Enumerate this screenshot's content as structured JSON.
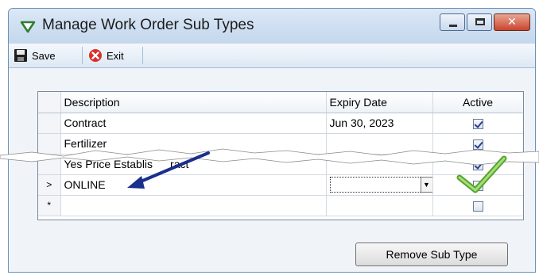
{
  "window": {
    "title": "Manage Work Order Sub Types",
    "controls": {
      "minimize": "minimize",
      "maximize": "maximize",
      "close": "x"
    }
  },
  "toolbar": {
    "save_label": "Save",
    "exit_label": "Exit"
  },
  "grid": {
    "columns": [
      "Description",
      "Expiry Date",
      "Active"
    ],
    "rows": [
      {
        "marker": "",
        "description": "Contract",
        "expiry": "Jun 30, 2023",
        "active": true
      },
      {
        "marker": "",
        "description": "Fertilizer",
        "expiry": "",
        "active": true
      },
      {
        "marker": "",
        "description": "Yes Price Establis",
        "suffix": "ract",
        "expiry": "",
        "active": true
      },
      {
        "marker": ">",
        "description": "ONLINE",
        "expiry": "",
        "active": false
      },
      {
        "marker": "*",
        "description": "",
        "expiry": "",
        "active": false
      }
    ]
  },
  "buttons": {
    "remove_label": "Remove Sub Type"
  },
  "annotation": {
    "arrow_color": "#1b2f8c",
    "check_color": "#7ac943"
  }
}
